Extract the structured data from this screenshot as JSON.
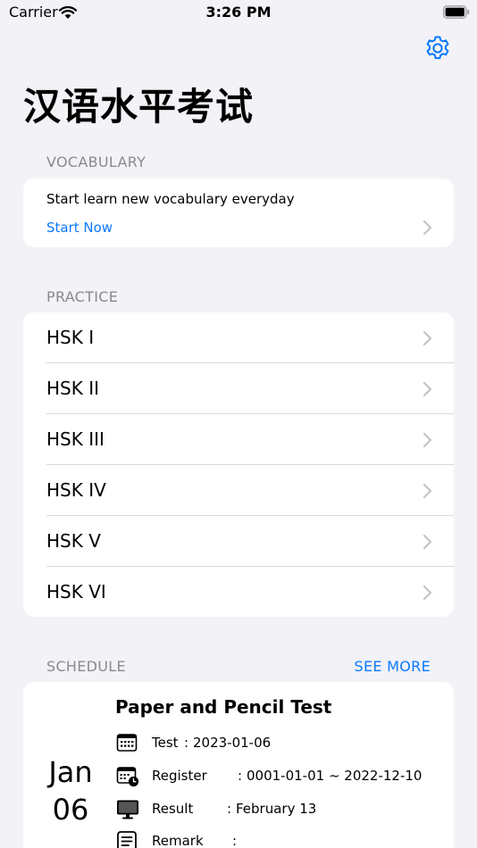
{
  "status_bar": {
    "carrier": "Carrier",
    "time": "3:26 PM"
  },
  "header": {
    "title": "汉语水平考试",
    "settings_icon": "gear-icon"
  },
  "vocabulary": {
    "section_title": "VOCABULARY",
    "description": "Start learn new vocabulary everyday",
    "action_label": "Start Now"
  },
  "practice": {
    "section_title": "PRACTICE",
    "items": [
      {
        "label": "HSK I"
      },
      {
        "label": "HSK II"
      },
      {
        "label": "HSK III"
      },
      {
        "label": "HSK IV"
      },
      {
        "label": "HSK V"
      },
      {
        "label": "HSK VI"
      }
    ]
  },
  "schedule": {
    "section_title": "SCHEDULE",
    "see_more_label": "SEE MORE",
    "event": {
      "title": "Paper and Pencil Test",
      "month": "Jan",
      "day": "06",
      "rows": [
        {
          "icon": "calendar-icon",
          "label": "Test",
          "value": "2023-01-06"
        },
        {
          "icon": "calendar-clock-icon",
          "label": "Register",
          "value": "0001-01-01 ~ 2022-12-10"
        },
        {
          "icon": "monitor-icon",
          "label": "Result",
          "value": "February 13"
        },
        {
          "icon": "document-icon",
          "label": "Remark",
          "value": ""
        }
      ]
    }
  },
  "colors": {
    "accent": "#0a7aff",
    "background": "#f2f2f7",
    "secondary_text": "#8a8a8e"
  }
}
